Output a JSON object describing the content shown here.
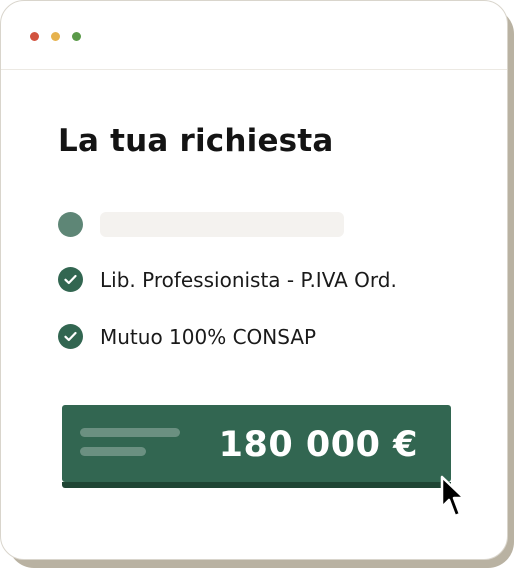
{
  "window": {
    "dots": [
      "red",
      "yellow",
      "green"
    ]
  },
  "card": {
    "title": "La tua richiesta",
    "items": [
      {
        "label": "Lib. Professionista - P.IVA Ord.",
        "icon": "check-circle-icon"
      },
      {
        "label": "Mutuo 100% CONSAP",
        "icon": "check-circle-icon"
      }
    ],
    "amount": "180 000 €"
  },
  "colors": {
    "primary": "#326651",
    "primary_dark": "#1f4534",
    "dot_red": "#d2533f",
    "dot_yellow": "#e6b24e",
    "dot_green": "#5a9a49",
    "placeholder_dot": "#5e8676",
    "placeholder_bar": "#f4f2ef"
  }
}
